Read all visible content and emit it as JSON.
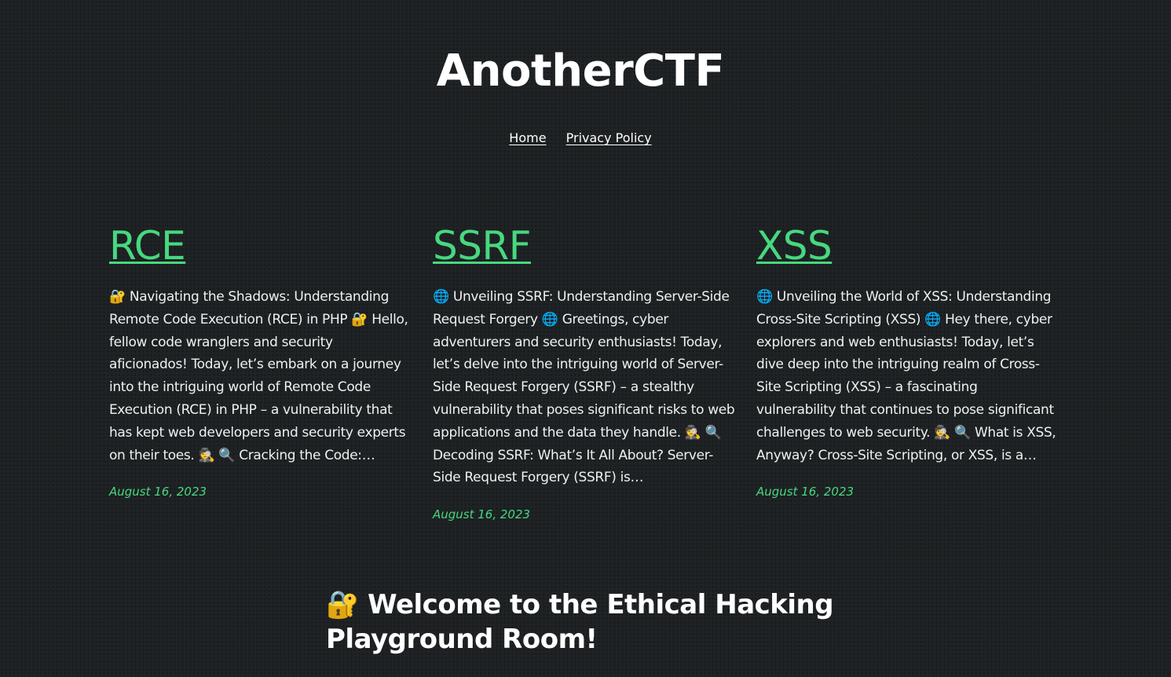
{
  "site": {
    "title": "AnotherCTF"
  },
  "nav": {
    "items": [
      {
        "label": "Home"
      },
      {
        "label": "Privacy Policy"
      }
    ]
  },
  "colors": {
    "background": "#1f2325",
    "accent": "#47d87f",
    "text": "#ffffff"
  },
  "posts": [
    {
      "title": "RCE",
      "excerpt": "🔐 Navigating the Shadows: Understanding Remote Code Execution (RCE) in PHP 🔐 Hello, fellow code wranglers and security aficionados! Today, let’s embark on a journey into the intriguing world of Remote Code Execution (RCE) in PHP – a vulnerability that has kept web developers and security experts on their toes. 🕵️ 🔍 Cracking the Code:…",
      "date": "August 16, 2023"
    },
    {
      "title": "SSRF",
      "excerpt": "🌐 Unveiling SSRF: Understanding Server-Side Request Forgery 🌐 Greetings, cyber adventurers and security enthusiasts! Today, let’s delve into the intriguing world of Server-Side Request Forgery (SSRF) – a stealthy vulnerability that poses significant risks to web applications and the data they handle. 🕵️ 🔍 Decoding SSRF: What’s It All About? Server-Side Request Forgery (SSRF) is…",
      "date": "August 16, 2023"
    },
    {
      "title": "XSS",
      "excerpt": "🌐 Unveiling the World of XSS: Understanding Cross-Site Scripting (XSS) 🌐 Hey there, cyber explorers and web enthusiasts! Today, let’s dive deep into the intriguing realm of Cross-Site Scripting (XSS) – a fascinating vulnerability that continues to pose significant challenges to web security. 🕵️ 🔍 What is XSS, Anyway? Cross-Site Scripting, or XSS, is a…",
      "date": "August 16, 2023"
    }
  ],
  "welcome": {
    "heading": "🔐 Welcome to the Ethical Hacking Playground Room!"
  }
}
